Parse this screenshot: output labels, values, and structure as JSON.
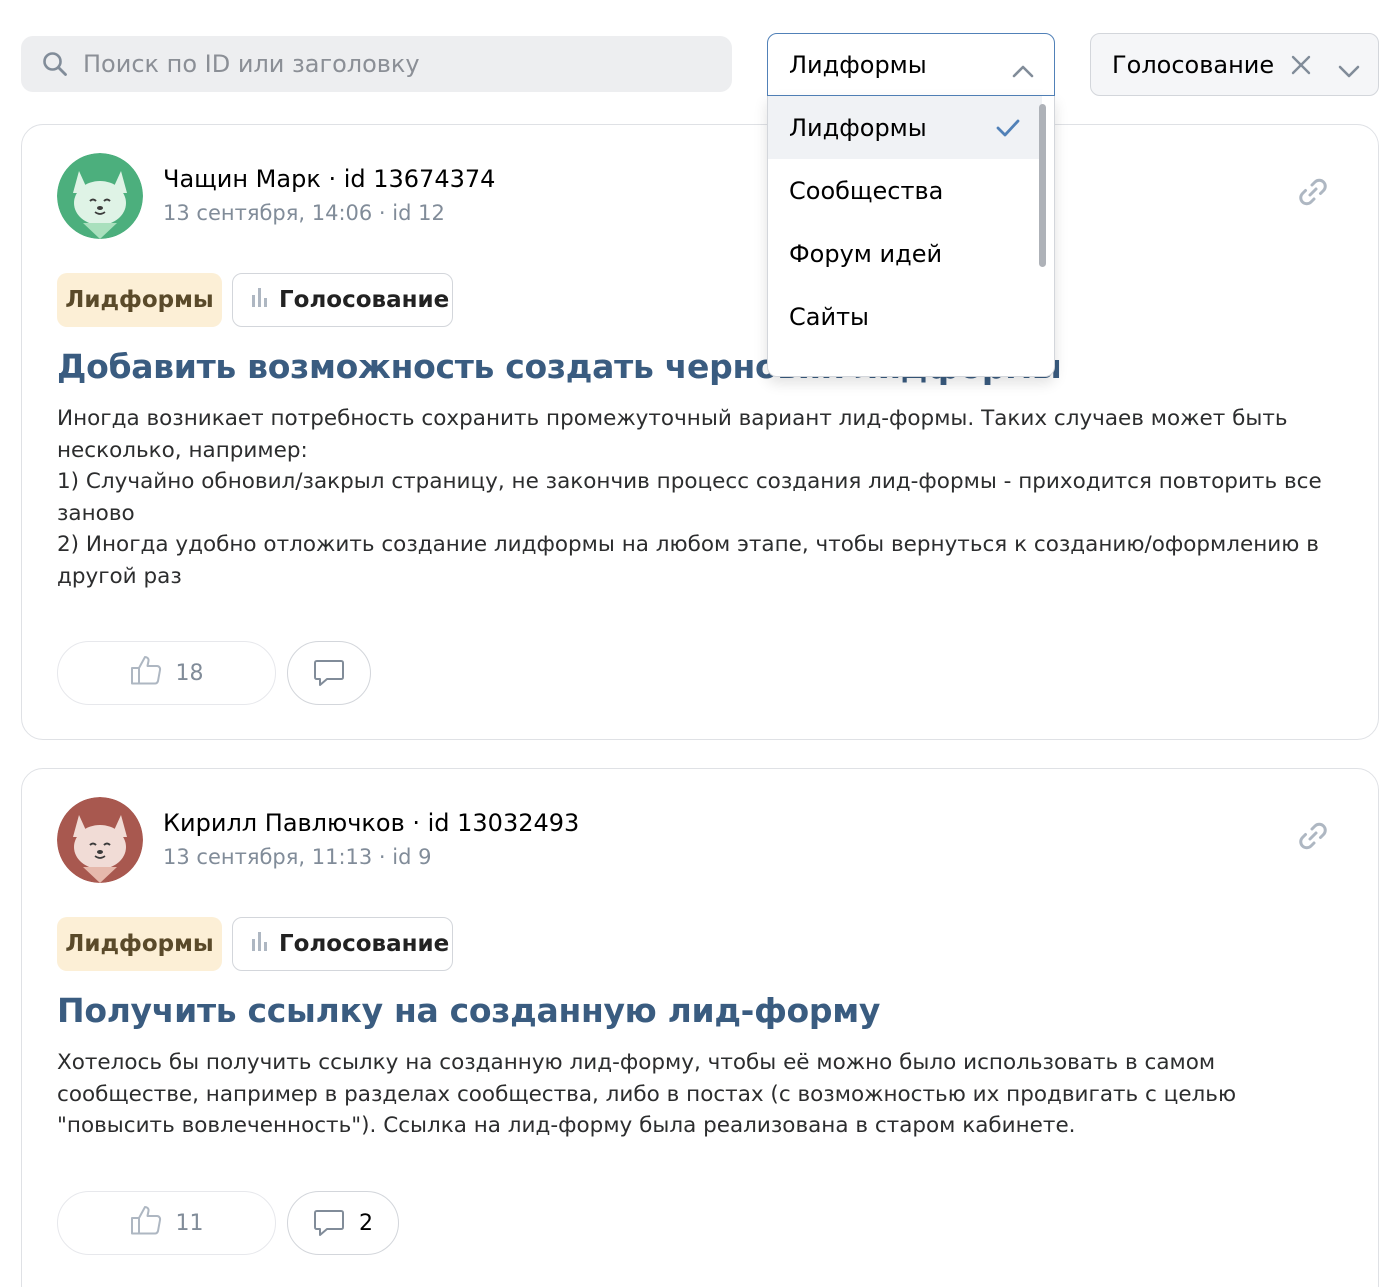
{
  "search": {
    "placeholder": "Поиск по ID или заголовку"
  },
  "filters": {
    "type": {
      "value": "Лидформы",
      "open": true
    },
    "status": {
      "value": "Голосование"
    }
  },
  "dropdown": {
    "options": [
      "Лидформы",
      "Сообщества",
      "Форум идей",
      "Сайты"
    ],
    "selected": "Лидформы"
  },
  "posts": [
    {
      "author": "Чащин Марк · id 13674374",
      "meta": "13 сентября, 14:06 · id 12",
      "avatar_color": "#4caf7d",
      "tag_type": "Лидформы",
      "tag_status": "Голосование",
      "title": "Добавить возможность создать черновик лидформы",
      "body": [
        "Иногда возникает потребность сохранить промежуточный вариант лид-формы. Таких случаев может быть несколько, например:",
        "1) Случайно обновил/закрыл страницу, не закончив процесс создания лид-формы - приходится повторить все заново",
        "2) Иногда удобно отложить создание лидформы на любом этапе, чтобы вернуться к созданию/оформлению в другой раз"
      ],
      "likes": "18",
      "comments": ""
    },
    {
      "author": "Кирилл Павлючков · id 13032493",
      "meta": "13 сентября, 11:13 · id 9",
      "avatar_color": "#a8584f",
      "tag_type": "Лидформы",
      "tag_status": "Голосование",
      "title": "Получить ссылку на созданную лид-форму",
      "body": [
        "Хотелось бы получить ссылку на созданную лид-форму, чтобы её можно было использовать в самом сообществе, например в разделах сообщества, либо в постах (с возможностью их продвигать с целью \"повысить вовлеченность\"). Ссылка на лид-форму была реализована в старом кабинете."
      ],
      "likes": "11",
      "comments": "2"
    }
  ],
  "colors": {
    "accent": "#5181b8",
    "title": "#3a5c80",
    "tag_type_bg": "#fcefd6",
    "muted": "#818c99"
  }
}
